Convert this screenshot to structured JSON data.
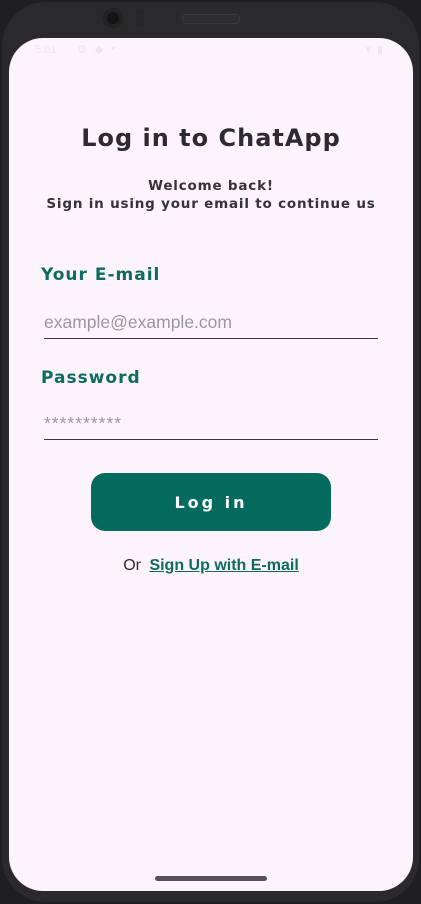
{
  "status_bar": {
    "time": "5:01",
    "left_icons": [
      "settings-icon",
      "shield-icon",
      "sim-icon"
    ],
    "right_icons": [
      "wifi-icon",
      "battery-icon"
    ]
  },
  "login": {
    "title": "Log in to ChatApp",
    "subtitle_line1": "Welcome back!",
    "subtitle_line2": "Sign in using your email to continue us",
    "email_label": "Your E-mail",
    "email_placeholder": "example@example.com",
    "password_label": "Password",
    "password_placeholder": "**********",
    "login_button": "Log in",
    "or_text": "Or",
    "signup_link": "Sign Up with E-mail"
  },
  "colors": {
    "accent": "#046b5e",
    "label": "#0d6b5f",
    "background": "#fdf3fb",
    "text": "#2d2a30"
  }
}
